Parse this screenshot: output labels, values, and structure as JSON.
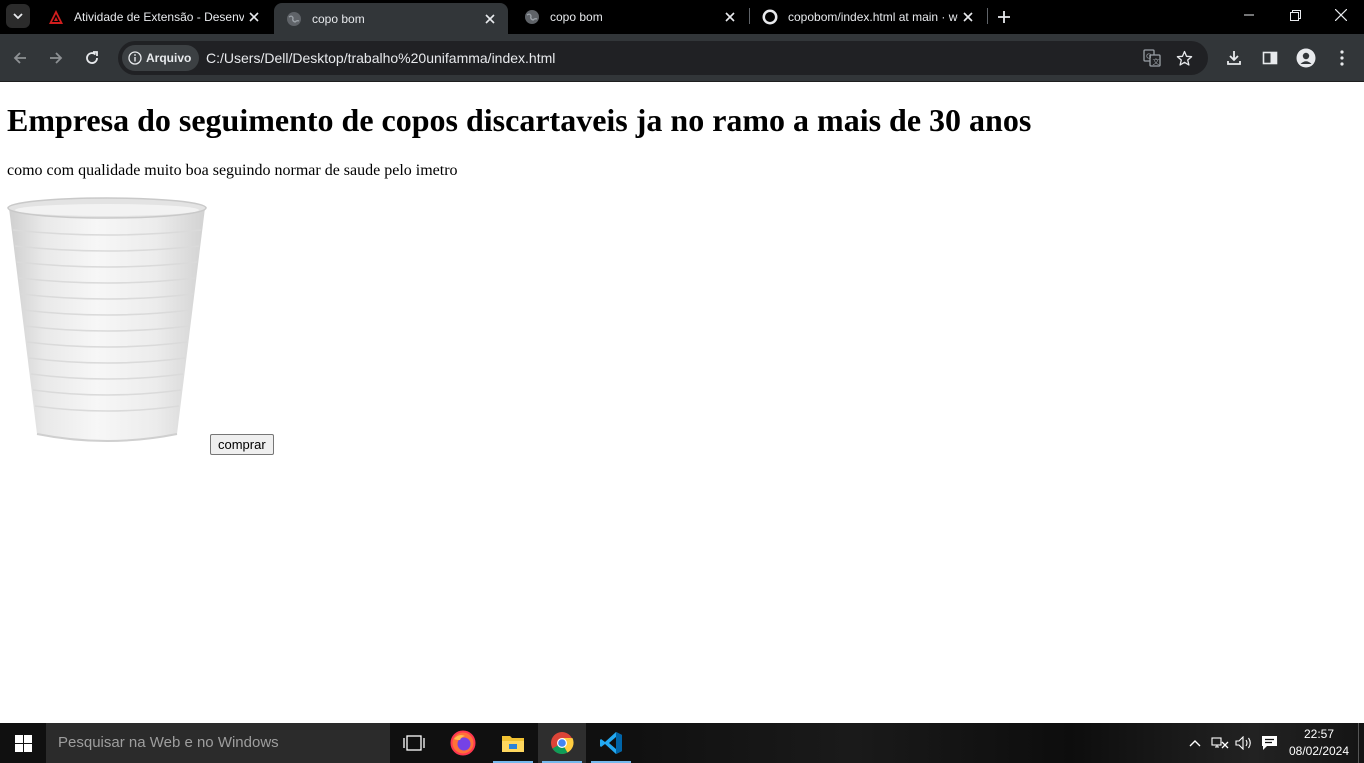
{
  "browser": {
    "tabs": [
      {
        "title": "Atividade de Extensão - Desenvolvimento",
        "active": false
      },
      {
        "title": "copo bom",
        "active": true
      },
      {
        "title": "copo bom",
        "active": false
      },
      {
        "title": "copobom/index.html at main · wellington",
        "active": false
      }
    ],
    "address_bar": {
      "security_chip": "Arquivo",
      "url": "C:/Users/Dell/Desktop/trabalho%20unifamma/index.html"
    }
  },
  "page": {
    "heading": "Empresa do seguimento de copos discartaveis ja no ramo a mais de 30 anos",
    "paragraph": "como com qualidade muito boa seguindo normar de saude pelo imetro",
    "buy_button": "comprar",
    "image": "disposable-plastic-cup"
  },
  "taskbar": {
    "search_placeholder": "Pesquisar na Web e no Windows",
    "apps": [
      "task-view",
      "firefox",
      "file-explorer",
      "chrome",
      "vscode"
    ],
    "active_app": "chrome",
    "time": "22:57",
    "date": "08/02/2024"
  },
  "colors": {
    "tab_strip": "#000000",
    "toolbar": "#323639",
    "omnibox": "#202124",
    "taskbar": "#101010",
    "taskbar_active_indicator": "#76b9ed"
  }
}
